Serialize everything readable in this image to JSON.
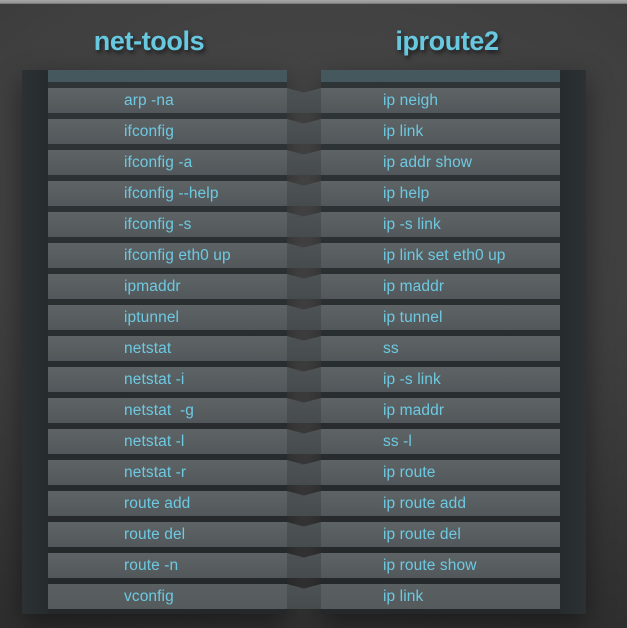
{
  "page": {
    "title": "net-tools vs iproute2 command comparison",
    "background_color": "#3c3c3c",
    "accent_color": "#6dc9e2",
    "row_color": "#5a6063",
    "frame_color": "#2a2f31",
    "bevel_color": "#44585e"
  },
  "columns": [
    {
      "id": "net-tools",
      "heading": "net-tools",
      "commands": [
        "arp -na",
        "ifconfig",
        "ifconfig -a",
        "ifconfig --help",
        "ifconfig -s",
        "ifconfig eth0 up",
        "ipmaddr",
        "iptunnel",
        "netstat",
        "netstat -i",
        "netstat  -g",
        "netstat -l",
        "netstat -r",
        "route add",
        "route del",
        "route -n",
        "vconfig"
      ]
    },
    {
      "id": "iproute2",
      "heading": "iproute2",
      "commands": [
        "ip neigh",
        "ip link",
        "ip addr show",
        "ip help",
        "ip -s link",
        "ip link set eth0 up",
        "ip maddr",
        "ip tunnel",
        "ss",
        "ip -s link",
        "ip maddr",
        "ss -l",
        "ip route",
        "ip route add",
        "ip route del",
        "ip route show",
        "ip link"
      ]
    }
  ]
}
